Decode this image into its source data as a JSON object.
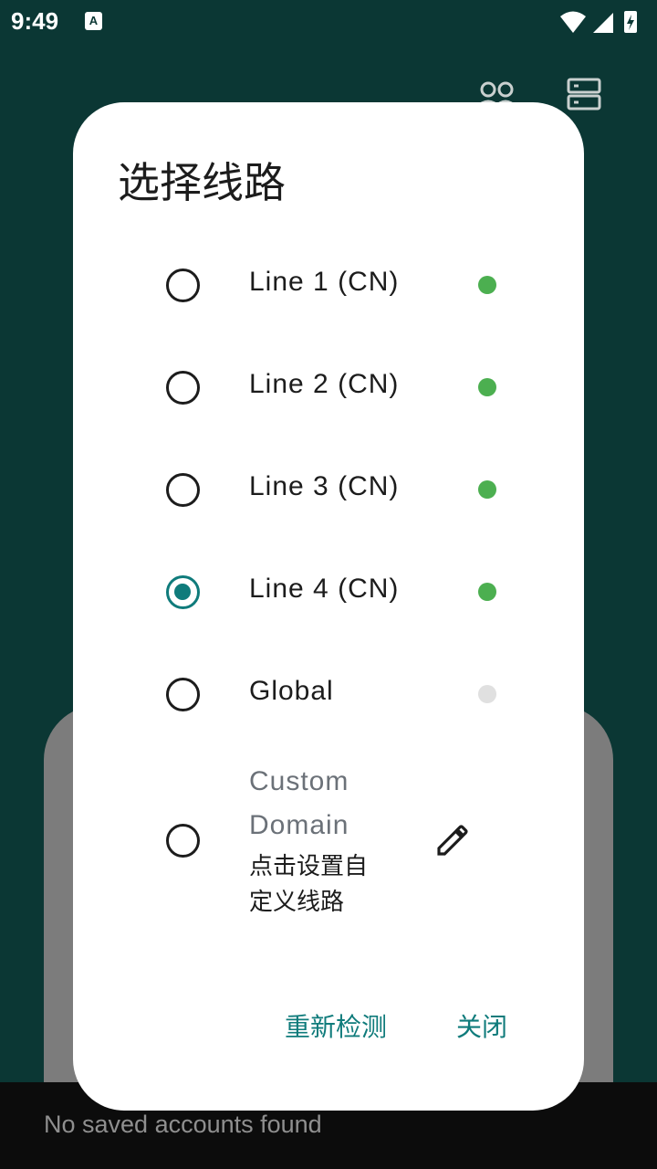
{
  "status_bar": {
    "time": "9:49",
    "notification_badge": "A"
  },
  "background": {
    "bottom_message": "No saved accounts found"
  },
  "dialog": {
    "title": "选择线路",
    "options": [
      {
        "label": "Line 1 (CN)",
        "selected": false,
        "status_color": "#4caf50"
      },
      {
        "label": "Line 2 (CN)",
        "selected": false,
        "status_color": "#4caf50"
      },
      {
        "label": "Line 3 (CN)",
        "selected": false,
        "status_color": "#4caf50"
      },
      {
        "label": "Line 4 (CN)",
        "selected": true,
        "status_color": "#4caf50"
      },
      {
        "label": "Global",
        "selected": false,
        "status_color": "#e0e0e0"
      }
    ],
    "custom": {
      "label": "Custom Domain",
      "hint": "点击设置自定义线路",
      "icon": "pencil-icon"
    },
    "actions": {
      "retest": "重新检测",
      "close": "关闭"
    }
  },
  "colors": {
    "accent": "#0f7b7b",
    "online": "#4caf50",
    "offline": "#e0e0e0"
  }
}
